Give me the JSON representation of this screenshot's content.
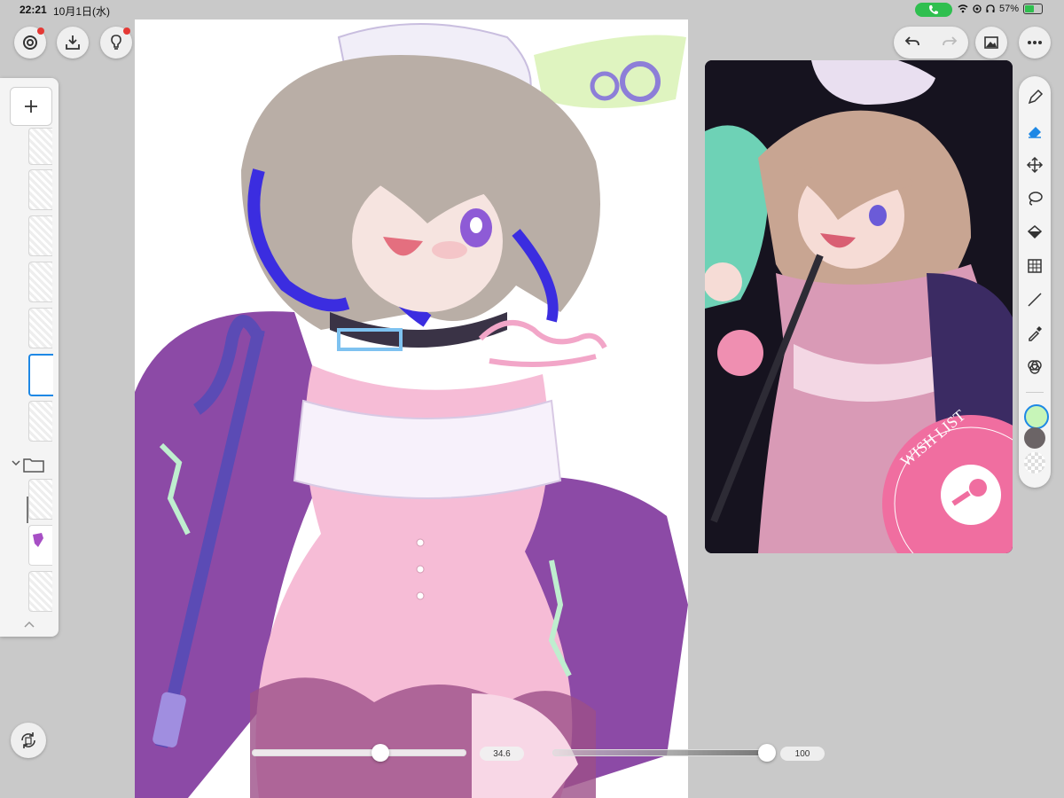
{
  "status_bar": {
    "time": "22:21",
    "date": "10月1日(水)",
    "battery_percent": "57%",
    "battery_level": 0.57,
    "call_color": "#2fbf4f"
  },
  "toolbar": {
    "left_buttons": [
      "gallery-icon",
      "import-icon",
      "tips-icon"
    ],
    "right_buttons": [
      "undo-icon",
      "redo-icon",
      "reference-image-icon",
      "more-icon"
    ]
  },
  "tools": [
    "pen-icon",
    "eraser-icon",
    "move-icon",
    "lasso-icon",
    "fill-icon",
    "transform-icon",
    "line-icon",
    "eyedropper-icon",
    "color-mix-icon"
  ],
  "colors": {
    "primary": "#c7f5b8",
    "secondary": "#6b6466",
    "transparent": "checker"
  },
  "sliders": {
    "brush_size": {
      "value": "34.6",
      "fraction": 0.6
    },
    "opacity": {
      "value": "100",
      "fraction": 1.0
    }
  },
  "reference": {
    "badge_text": "WISH LIST",
    "badge_color": "#f06ea0"
  }
}
